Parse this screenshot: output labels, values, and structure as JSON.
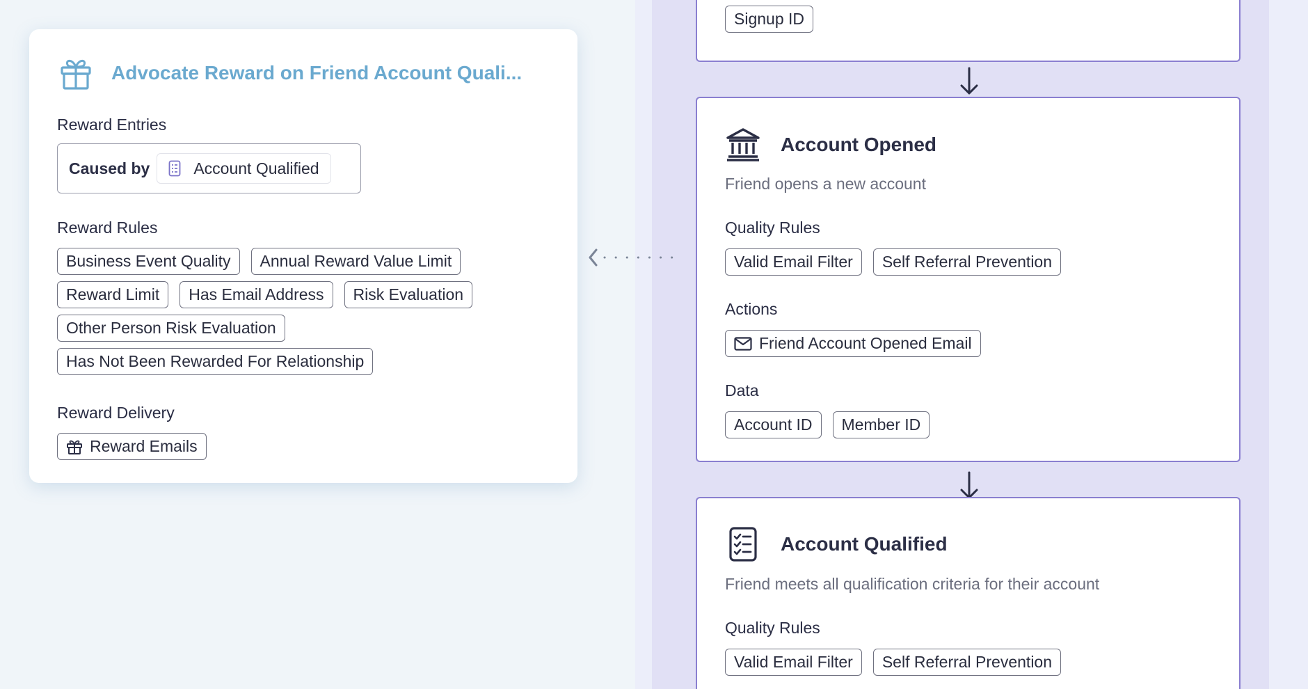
{
  "reward_card": {
    "title": "Advocate Reward on Friend Account Quali...",
    "icon": "gift-icon",
    "entries_label": "Reward Entries",
    "caused_by_label": "Caused by",
    "caused_by_value": "Account Qualified",
    "rules_label": "Reward Rules",
    "rules": [
      "Business Event Quality",
      "Annual Reward Value Limit",
      "Reward Limit",
      "Has Email Address",
      "Risk Evaluation",
      "Other Person Risk Evaluation",
      "Has Not Been Rewarded For Relationship"
    ],
    "delivery_label": "Reward Delivery",
    "delivery_item": "Reward Emails"
  },
  "flow": {
    "top_step": {
      "data_chips": [
        "Signup ID"
      ]
    },
    "account_opened": {
      "icon": "bank-icon",
      "title": "Account Opened",
      "description": "Friend opens a new account",
      "quality_label": "Quality Rules",
      "quality_rules": [
        "Valid Email Filter",
        "Self Referral Prevention"
      ],
      "actions_label": "Actions",
      "actions": [
        "Friend Account Opened Email"
      ],
      "data_label": "Data",
      "data": [
        "Account ID",
        "Member ID"
      ]
    },
    "account_qualified": {
      "icon": "checklist-icon",
      "title": "Account Qualified",
      "description": "Friend meets all qualification criteria for their account",
      "quality_label": "Quality Rules",
      "quality_rules": [
        "Valid Email Filter",
        "Self Referral Prevention"
      ]
    }
  },
  "colors": {
    "accent_title": "#6aa9cf",
    "step_border": "#8a7fd0",
    "lane_bg": "#e1e0f5",
    "page_bg": "#f0f5f9"
  }
}
